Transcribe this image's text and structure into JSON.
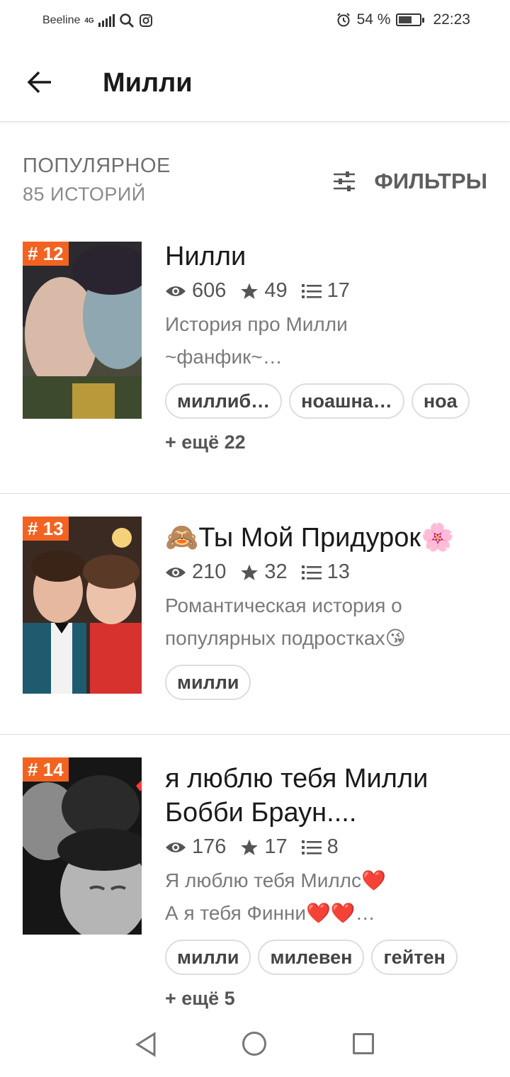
{
  "status_bar": {
    "carrier": "Beeline",
    "network": "4G",
    "battery": "54 %",
    "battery_level": 0.54,
    "time": "22:23"
  },
  "app_bar": {
    "title": "Милли",
    "back_icon": "arrow-left-icon"
  },
  "section": {
    "title": "ПОПУЛЯРНОЕ",
    "count": "85 ИСТОРИЙ",
    "filters_label": "ФИЛЬТРЫ",
    "filters_icon": "filter-sliders-icon"
  },
  "colors": {
    "accent": "#f26322",
    "text_primary": "#1a1a1a",
    "text_secondary": "#7a7a7a"
  },
  "stories": [
    {
      "rank": "# 12",
      "title": "Нилли",
      "views": "606",
      "votes": "49",
      "parts": "17",
      "description": "История про Милли ~фанфик~…",
      "tags": [
        "миллиб…",
        "ноашна…",
        "ноа"
      ],
      "more": "+ ещё 22"
    },
    {
      "rank": "# 13",
      "title": "🙈Ты Мой Придурок🌸",
      "views": "210",
      "votes": "32",
      "parts": "13",
      "description": "Романтическая история о популярных подростках😘",
      "tags": [
        "милли"
      ]
    },
    {
      "rank": "# 14",
      "title": "я люблю тебя Милли Бобби Браун....",
      "views": "176",
      "votes": "17",
      "parts": "8",
      "description_line1": "Я люблю тебя Миллс❤️",
      "description_line2": "А я тебя Финни❤️❤️…",
      "tags": [
        "милли",
        "милевен",
        "гейтен"
      ],
      "more": "+ ещё 5"
    }
  ],
  "nav": {
    "back": "nav-back-icon",
    "home": "nav-home-icon",
    "recents": "nav-recents-icon"
  }
}
